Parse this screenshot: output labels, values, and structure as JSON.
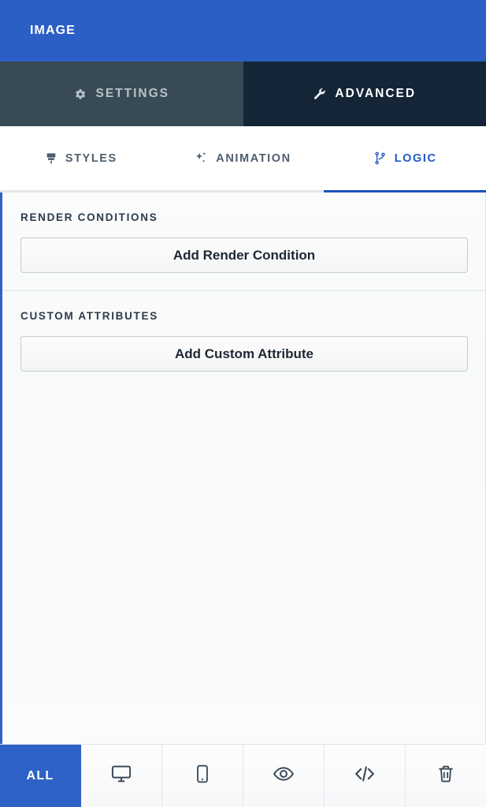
{
  "header": {
    "title": "IMAGE",
    "background_color": "#2c5fc5"
  },
  "primary_tabs": [
    {
      "label": "SETTINGS",
      "icon": "gear-icon",
      "active": false
    },
    {
      "label": "ADVANCED",
      "icon": "wrench-icon",
      "active": true
    }
  ],
  "secondary_tabs": [
    {
      "label": "STYLES",
      "icon": "paintbrush-icon",
      "active": false
    },
    {
      "label": "ANIMATION",
      "icon": "sparkles-icon",
      "active": false
    },
    {
      "label": "LOGIC",
      "icon": "git-branch-icon",
      "active": true
    }
  ],
  "sections": [
    {
      "title": "RENDER CONDITIONS",
      "button_label": "Add Render Condition"
    },
    {
      "title": "CUSTOM ATTRIBUTES",
      "button_label": "Add Custom Attribute"
    }
  ],
  "bottom_bar": {
    "all_label": "ALL",
    "items": [
      {
        "icon": "desktop-monitor-icon"
      },
      {
        "icon": "mobile-phone-icon"
      },
      {
        "icon": "eye-icon"
      },
      {
        "icon": "code-brackets-icon"
      },
      {
        "icon": "trash-icon"
      }
    ]
  },
  "colors": {
    "accent_blue": "#2f62c6",
    "active_tab_blue": "#2258c4",
    "dark_panel": "#132536",
    "muted_panel": "#384a55"
  }
}
